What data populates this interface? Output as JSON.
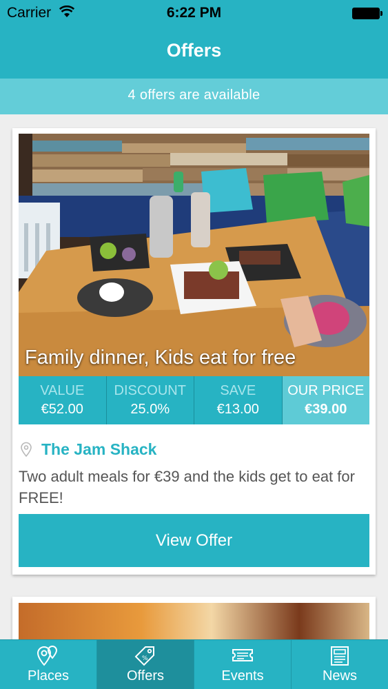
{
  "status": {
    "carrier": "Carrier",
    "time": "6:22 PM"
  },
  "navbar": {
    "title": "Offers"
  },
  "subbar": {
    "text": "4 offers are available"
  },
  "offers": [
    {
      "photo_caption": "Family dinner, Kids eat for free",
      "prices": [
        {
          "label": "VALUE",
          "value": "€52.00"
        },
        {
          "label": "DISCOUNT",
          "value": "25.0%"
        },
        {
          "label": "SAVE",
          "value": "€13.00"
        },
        {
          "label": "OUR PRICE",
          "value": "€39.00"
        }
      ],
      "venue": "The Jam Shack",
      "description": "Two adult meals for €39 and the kids get to eat for FREE!",
      "button_label": "View Offer"
    }
  ],
  "tabs": [
    {
      "label": "Places",
      "icon": "map-pin-icon"
    },
    {
      "label": "Offers",
      "icon": "price-tag-icon"
    },
    {
      "label": "Events",
      "icon": "ticket-icon"
    },
    {
      "label": "News",
      "icon": "newspaper-icon"
    }
  ],
  "colors": {
    "primary": "#27b3c3",
    "secondary": "#63cdd8",
    "active_tab": "#1e8f9c"
  },
  "active_tab": "Offers"
}
